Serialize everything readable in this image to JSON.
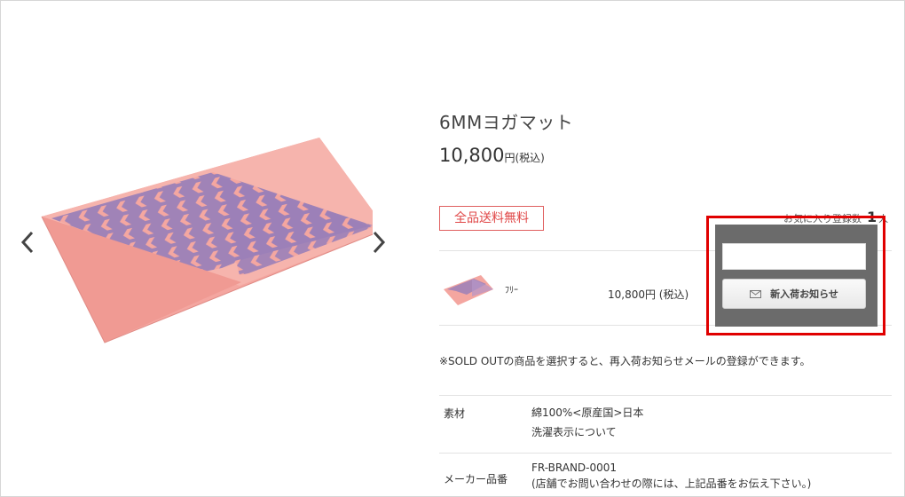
{
  "product": {
    "title": "6MMヨガマット",
    "price_number": "10,800",
    "price_suffix": "円(税込)",
    "badge": "全品送料無料"
  },
  "favorite": {
    "label": "お気に入り登録数",
    "count": "1",
    "unit": "人"
  },
  "variant": {
    "size": "ﾌﾘｰ",
    "price": "10,800円 (税込)"
  },
  "restock_popup": {
    "input_value": "",
    "button_label": "新入荷お知らせ",
    "button_icon": "mail-icon"
  },
  "note": "※SOLD OUTの商品を選択すると、再入荷お知らせメールの登録ができます。",
  "specs": [
    {
      "label": "素材",
      "lines": [
        "綿100%<原産国>日本",
        "洗濯表示について"
      ]
    },
    {
      "label": "メーカー品番",
      "lines": [
        "FR-BRAND-0001",
        "(店舗でお問い合わせの際には、上記品番をお伝え下さい。)"
      ]
    }
  ],
  "colors": {
    "mat_pink": "#f4a6a0",
    "mat_purple": "#9b80b8",
    "badge_red": "#e04848",
    "popup_gray": "#6b6b6b",
    "highlight_red": "#e00000"
  }
}
